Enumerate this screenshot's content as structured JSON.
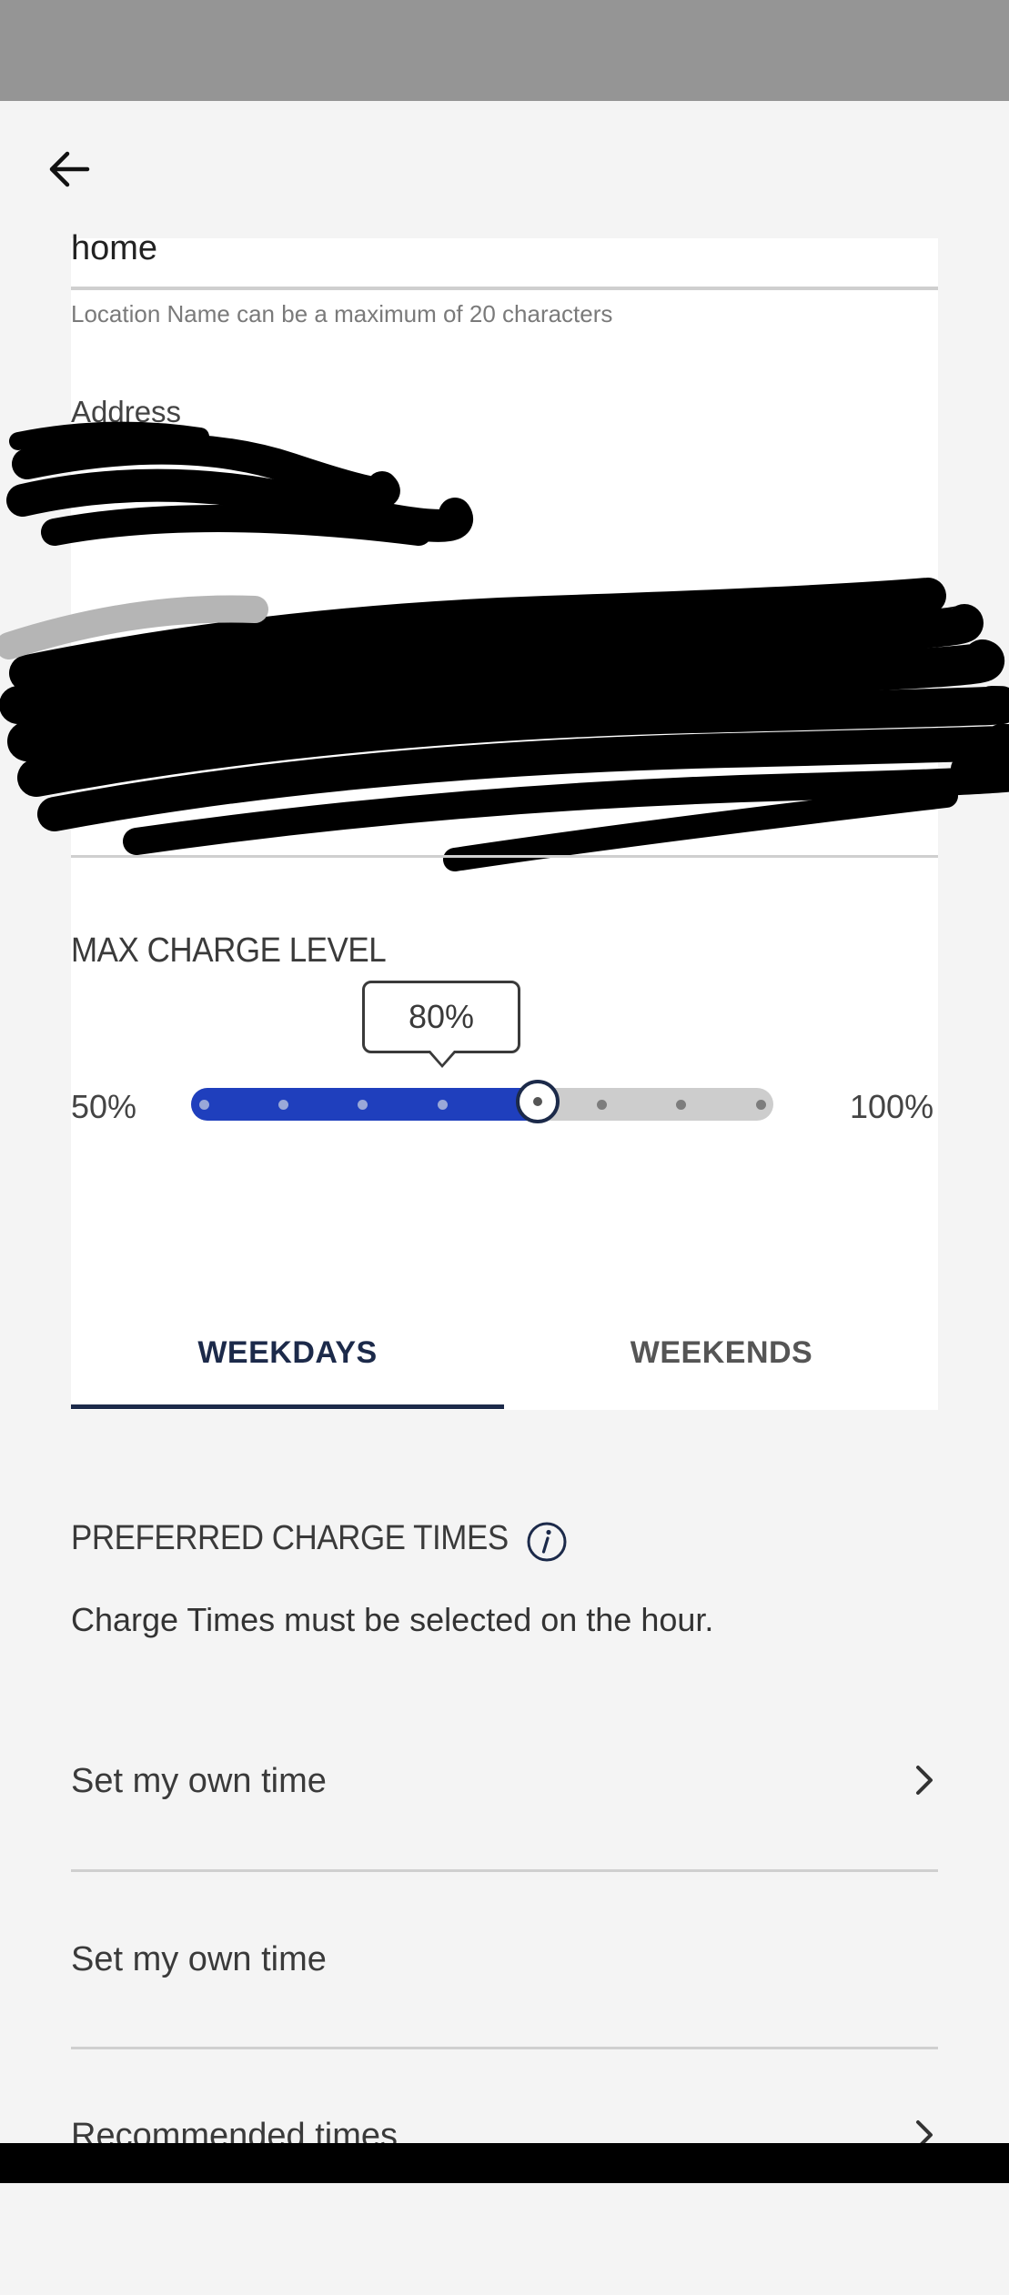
{
  "location": {
    "name_value": "home",
    "name_helper": "Location Name can be a maximum of 20 characters",
    "address_label": "Address"
  },
  "max_charge": {
    "title": "MAX CHARGE LEVEL",
    "value_label": "80%",
    "value_percent": 80,
    "min_label": "50%",
    "max_label": "100%",
    "min_value": 50,
    "max_value": 100,
    "steps": 8,
    "accent_color": "#1f3fbd"
  },
  "tabs": {
    "weekdays_label": "WEEKDAYS",
    "weekends_label": "WEEKENDS",
    "selected": "weekdays"
  },
  "charge_times": {
    "title": "PREFERRED CHARGE TIMES",
    "subtitle": "Charge Times must be selected on the hour.",
    "items": [
      {
        "label": "Set my own time",
        "icon": "chevron-right-icon"
      },
      {
        "label": "Set my own time",
        "icon": ""
      },
      {
        "label": "Recommended times",
        "icon": "chevron-right-icon"
      }
    ]
  },
  "icons": {
    "back": "arrow-left-icon",
    "info": "info-icon"
  }
}
